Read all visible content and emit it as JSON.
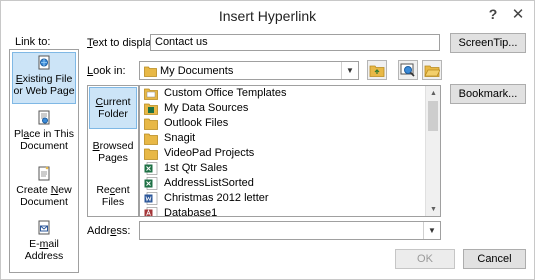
{
  "window": {
    "title": "Insert Hyperlink",
    "help_glyph": "?",
    "close_glyph": "✕"
  },
  "link_to": {
    "label": "Link to:",
    "items": [
      {
        "line1_pre": "",
        "line1_key": "E",
        "line1_post": "xisting File",
        "line2": "or Web Page",
        "icon": "existing-file-icon",
        "active": true
      },
      {
        "line1_pre": "Pl",
        "line1_key": "a",
        "line1_post": "ce in This",
        "line2": "Document",
        "icon": "place-in-document-icon",
        "active": false
      },
      {
        "line1_pre": "Create ",
        "line1_key": "N",
        "line1_post": "ew",
        "line2": "Document",
        "icon": "new-document-icon",
        "active": false
      },
      {
        "line1_pre": "E-",
        "line1_key": "m",
        "line1_post": "ail",
        "line2": "Address",
        "icon": "email-icon",
        "active": false
      }
    ]
  },
  "text_to_display": {
    "label_key": "T",
    "label_rest": "ext to display:",
    "value": "Contact us"
  },
  "screentip_button": "ScreenTip...",
  "look_in": {
    "label_pre": "",
    "label_key": "L",
    "label_rest": "ook in:",
    "value": "My Documents"
  },
  "bookmark_button": "Bookmark...",
  "sub_tabs": [
    {
      "line1_pre": "",
      "line1_key": "C",
      "line1_post": "urrent",
      "line2": "Folder",
      "active": true
    },
    {
      "line1_pre": "",
      "line1_key": "B",
      "line1_post": "rowsed",
      "line2": "Pages",
      "active": false
    },
    {
      "line1_pre": "Re",
      "line1_key": "c",
      "line1_post": "ent",
      "line2": "Files",
      "active": false
    }
  ],
  "files": [
    {
      "name": "Custom Office Templates",
      "type": "folder"
    },
    {
      "name": "My Data Sources",
      "type": "datafolder"
    },
    {
      "name": "Outlook Files",
      "type": "folder"
    },
    {
      "name": "Snagit",
      "type": "folder"
    },
    {
      "name": "VideoPad Projects",
      "type": "folder"
    },
    {
      "name": "1st Qtr Sales",
      "type": "excel"
    },
    {
      "name": "AddressListSorted",
      "type": "excel"
    },
    {
      "name": "Christmas 2012 letter",
      "type": "word"
    },
    {
      "name": "Database1",
      "type": "access"
    }
  ],
  "address": {
    "label_pre": "Addr",
    "label_key": "e",
    "label_rest": "ss:",
    "value": ""
  },
  "ok_button": "OK",
  "cancel_button": "Cancel",
  "colors": {
    "accent": "#cce4f7",
    "folder": "#e8b846",
    "excel": "#1e7145",
    "word": "#2b579a",
    "access": "#a4373a"
  }
}
